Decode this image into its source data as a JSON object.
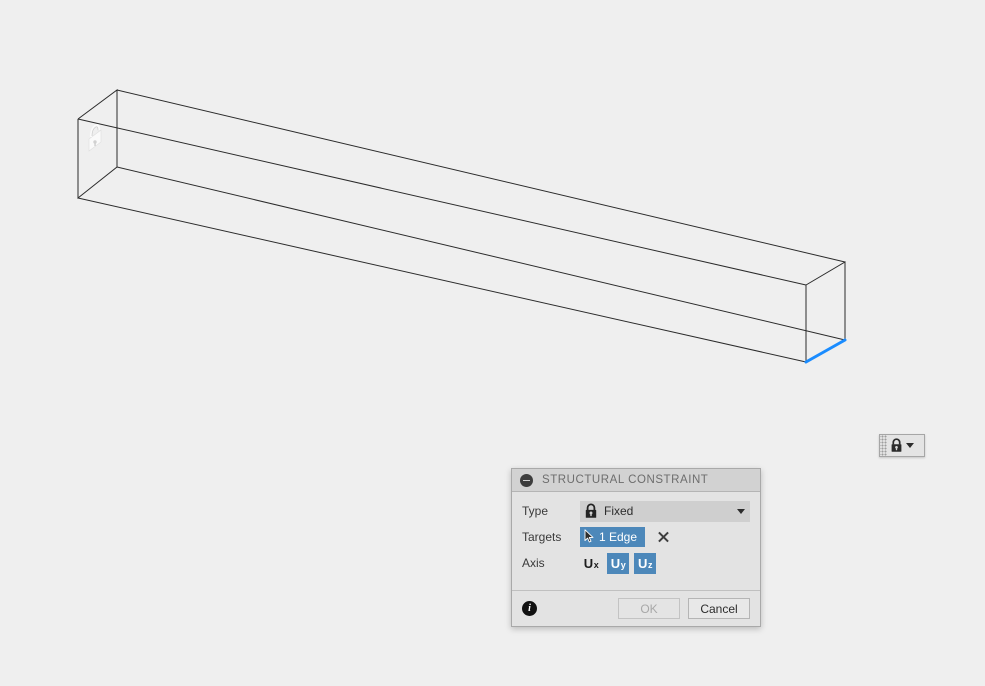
{
  "viewport": {
    "background_color": "#efefef",
    "model": {
      "name": "rectangular-beam",
      "edge_color": "#2b2b2b",
      "highlight_color": "#1a8cff",
      "fixed_marker_icon": "lock-icon",
      "selected_edge_label": "bottom-front-right-edge"
    }
  },
  "mini_toolbar": {
    "name": "structural-constraint-mini-toolbar",
    "grip_label": "drag-handle",
    "buttons": [
      {
        "icon": "lock-icon",
        "label": "Structural Constraint",
        "has_dropdown": true
      }
    ]
  },
  "dialog": {
    "title": "STRUCTURAL CONSTRAINT",
    "collapse_icon": "minus-circle-icon",
    "rows": {
      "type": {
        "label": "Type",
        "icon": "lock-icon",
        "value": "Fixed",
        "dropdown_icon": "chevron-down-icon"
      },
      "targets": {
        "label": "Targets",
        "chip_icon": "cursor-arrow-icon",
        "chip_value": "1 Edge",
        "clear_icon": "close-x-icon"
      },
      "axis": {
        "label": "Axis",
        "buttons": [
          {
            "base": "U",
            "sub": "x",
            "selected": false
          },
          {
            "base": "U",
            "sub": "y",
            "selected": true
          },
          {
            "base": "U",
            "sub": "z",
            "selected": true
          }
        ]
      }
    },
    "footer": {
      "info_icon": "info-icon",
      "info_glyph": "i",
      "ok_label": "OK",
      "ok_enabled": false,
      "cancel_label": "Cancel"
    },
    "colors": {
      "accent_blue": "#4d88ba",
      "titlebar": "#d2d2d2",
      "body": "#e3e3e3"
    }
  }
}
